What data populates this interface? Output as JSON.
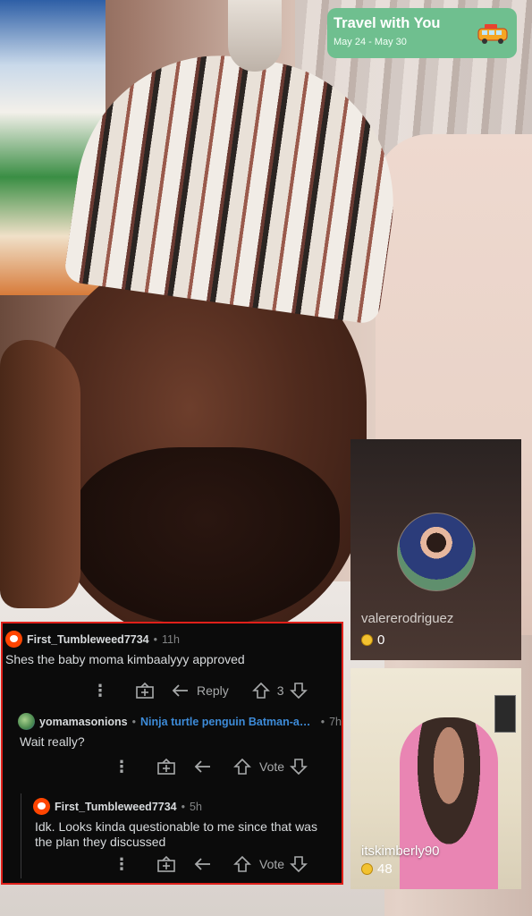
{
  "travel_banner": {
    "title": "Travel with You",
    "dates": "May 24 - May 30",
    "icon": "bus-icon",
    "color": "#6fbf8f"
  },
  "guests": [
    {
      "name": "valererodriguez",
      "coins": "0"
    },
    {
      "name": "itskimberly90",
      "coins": "48"
    }
  ],
  "comments": [
    {
      "user": "First_Tumbleweed7734",
      "time": "11h",
      "text": "Shes the baby moma  kimbaalyyy approved",
      "reply_label": "Reply",
      "vote_count": "3"
    },
    {
      "user": "yomamasonions",
      "flair": "Ninja turtle penguin Batman-ass ...",
      "time": "7h",
      "text": "Wait really?",
      "vote_label": "Vote"
    },
    {
      "user": "First_Tumbleweed7734",
      "time": "5h",
      "text": "Idk. Looks kinda questionable to me since that was the plan they discussed",
      "vote_label": "Vote"
    }
  ],
  "colors": {
    "highlight_border": "#e0201a",
    "flair": "#3d8bd8",
    "comment_bg": "#0b0b0b"
  }
}
